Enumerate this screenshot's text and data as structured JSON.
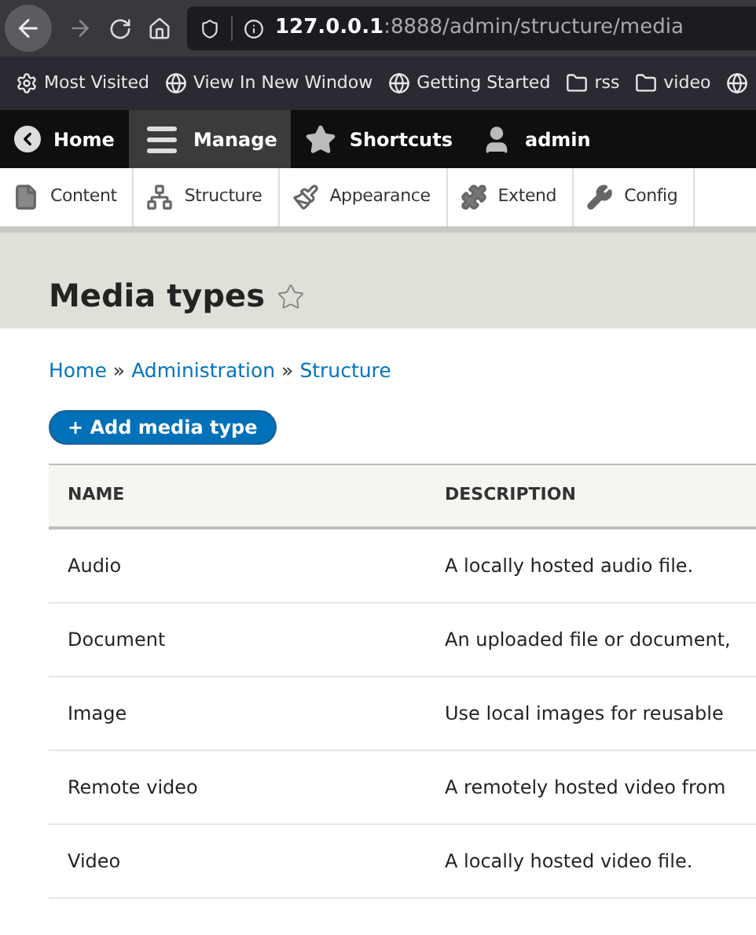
{
  "browser": {
    "url_host": "127.0.0.1",
    "url_path": ":8888/admin/structure/media",
    "bookmarks": [
      {
        "kind": "gear",
        "label": "Most Visited"
      },
      {
        "kind": "globe",
        "label": "View In New Window"
      },
      {
        "kind": "globe",
        "label": "Getting Started"
      },
      {
        "kind": "folder",
        "label": "rss"
      },
      {
        "kind": "folder",
        "label": "video"
      }
    ]
  },
  "toolbar": [
    {
      "kind": "back",
      "label": "Home",
      "selected": false
    },
    {
      "kind": "menu",
      "label": "Manage",
      "selected": true
    },
    {
      "kind": "star",
      "label": "Shortcuts",
      "selected": false
    },
    {
      "kind": "user",
      "label": "admin",
      "selected": false
    }
  ],
  "tray": [
    {
      "kind": "file",
      "label": "Content"
    },
    {
      "kind": "sitemap",
      "label": "Structure"
    },
    {
      "kind": "brush",
      "label": "Appearance"
    },
    {
      "kind": "puzzle",
      "label": "Extend"
    },
    {
      "kind": "wrench",
      "label": "Config"
    }
  ],
  "page": {
    "title": "Media types",
    "breadcrumb": [
      "Home",
      "Administration",
      "Structure"
    ],
    "breadcrumb_separator": "»",
    "add_button": "+ Add media type"
  },
  "table": {
    "columns": [
      "NAME",
      "DESCRIPTION"
    ],
    "rows": [
      [
        "Audio",
        "A locally hosted audio file."
      ],
      [
        "Document",
        "An uploaded file or document,"
      ],
      [
        "Image",
        "Use local images for reusable"
      ],
      [
        "Remote video",
        "A remotely hosted video from"
      ],
      [
        "Video",
        "A locally hosted video file."
      ]
    ]
  }
}
